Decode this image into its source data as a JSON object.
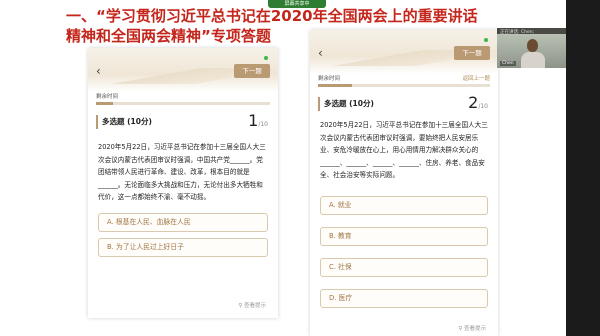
{
  "meeting": {
    "share_tab": "屏幕共享中",
    "video_label": "正在讲话: Chen;",
    "video_name": "Chen"
  },
  "slide": {
    "headline_line1": "一、“学习贯彻习近平总书记在2020年全国两会上的重要讲话",
    "headline_line2": "精神和全国两会精神”专项答题"
  },
  "phone1": {
    "next_label": "下一题",
    "timer_label": "剩余时间",
    "progress": 0.1,
    "question_type": "多选题 (10分)",
    "question_number": "1",
    "question_total": "/10",
    "question_text": "2020年5月22日，习近平总书记在参加十三届全国人大三次会议内蒙古代表团审议时强调，中国共产党______。党团结带领人民进行革命、建设、改革，根本目的就是______。无论面临多大挑战和压力，无论付出多大牺牲和代价，这一点都始终不渝、毫不动摇。",
    "options": [
      "A. 根基在人民、血脉在人民",
      "B. 为了让人民过上好日子"
    ],
    "hint": "查看提示"
  },
  "phone2": {
    "next_label": "下一题",
    "timer_label": "剩余时间",
    "prev_label": "返回上一题",
    "progress": 0.2,
    "question_type": "多选题 (10分)",
    "question_number": "2",
    "question_total": "/10",
    "question_text": "2020年5月22日，习近平总书记在参加十三届全国人大三次会议内蒙古代表团审议时强调，要始终把人民安居乐业、安危冷暖放在心上，用心用情用力解决群众关心的______、______、______、______、住房、养老、食品安全、社会治安等实际问题。",
    "options": [
      "A. 就业",
      "B. 教育",
      "C. 社保",
      "D. 医疗"
    ],
    "hint": "查看提示"
  },
  "colors": {
    "headline": "#c4261c",
    "accent": "#b99a72",
    "option_text": "#a07545"
  }
}
